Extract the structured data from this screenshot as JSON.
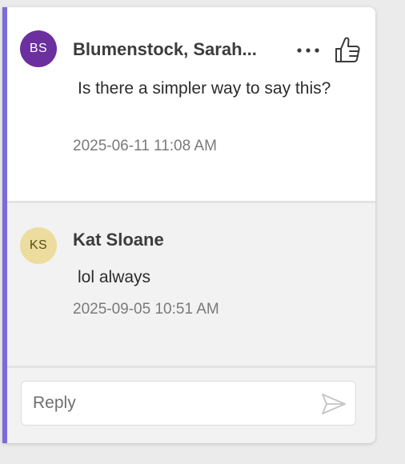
{
  "comment": {
    "author_initials": "BS",
    "author_name": "Blumenstock, Sarah...",
    "text": "Is there a simpler way to say this?",
    "timestamp": "2025-06-11 11:08 AM",
    "avatar_color": "#6b2fa0",
    "more_icon": "more-horizontal-icon",
    "like_icon": "thumbs-up-icon"
  },
  "reply": {
    "author_initials": "KS",
    "author_name": "Kat Sloane",
    "text": "lol always",
    "timestamp": "2025-09-05 10:51 AM",
    "avatar_color": "#ecdd9e"
  },
  "reply_box": {
    "placeholder": "Reply",
    "send_icon": "send-icon"
  },
  "accent_color": "#7b6cd9"
}
